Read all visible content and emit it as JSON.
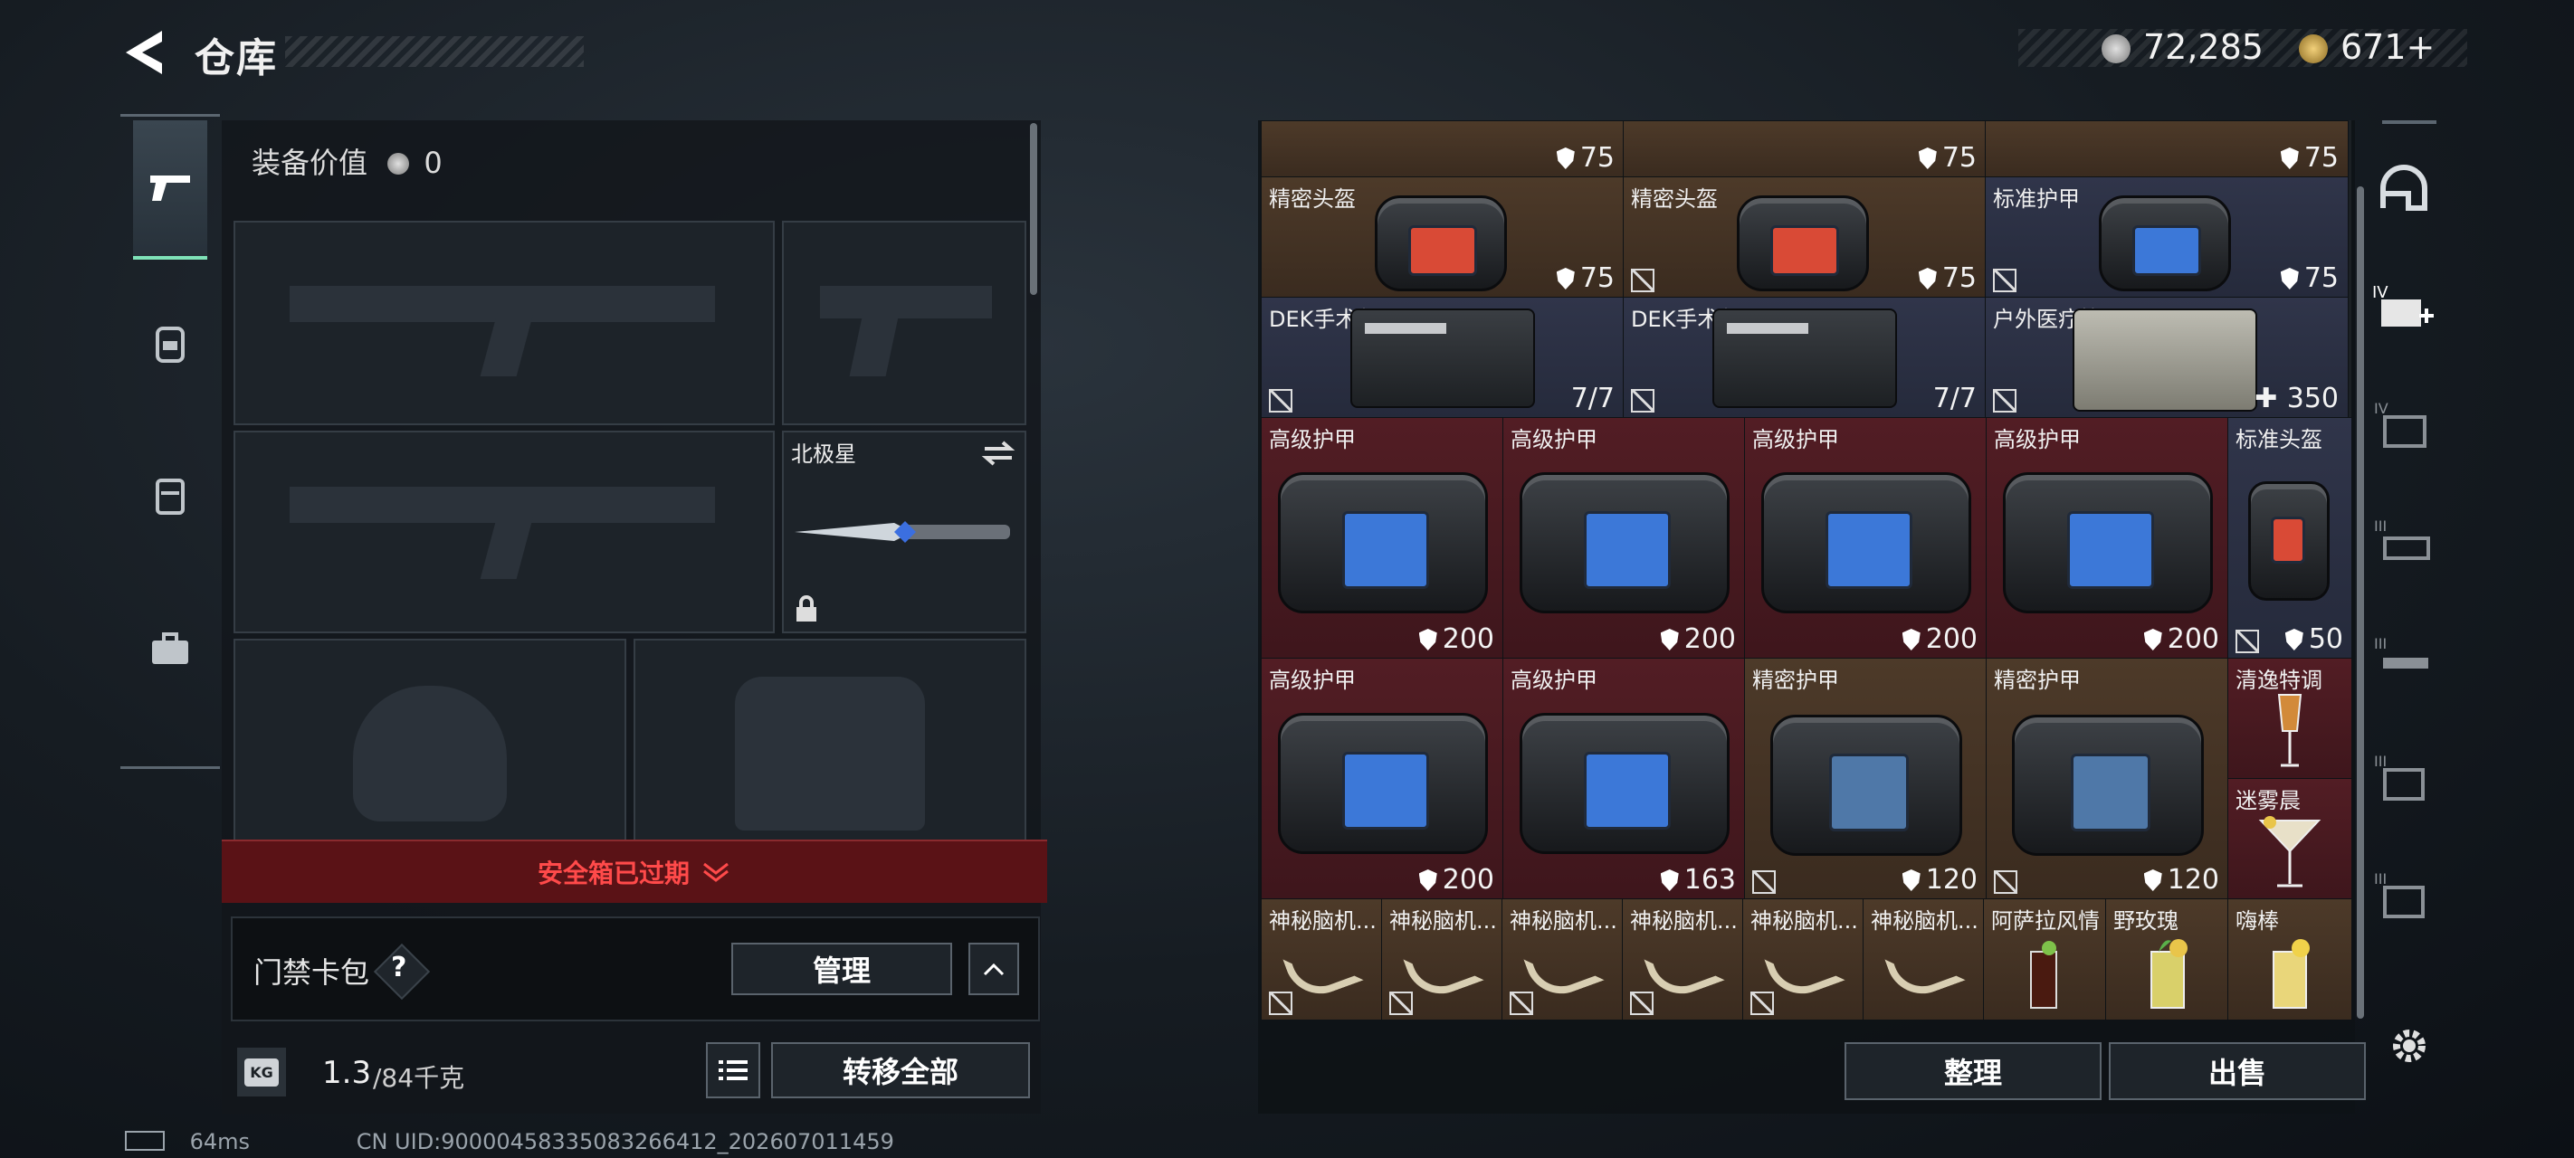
{
  "header": {
    "title": "仓库"
  },
  "currency": [
    {
      "value": "72,285",
      "color": "#b9b9b9"
    },
    {
      "value": "671+",
      "color": "#c7a24a"
    }
  ],
  "loadout": {
    "equipment_value_label": "装备价值",
    "equipment_value": "0",
    "melee_name": "北极星",
    "safe_box_text": "安全箱已过期",
    "access_card_label": "门禁卡包",
    "help_icon": "?",
    "manage_label": "管理",
    "weight_current": "1.3",
    "weight_max": "/84千克",
    "weight_badge": "KG",
    "transfer_all_label": "转移全部"
  },
  "stash": {
    "top_values": [
      "75",
      "75",
      "75"
    ],
    "row1": [
      {
        "name": "精密头盔",
        "value": "75"
      },
      {
        "name": "精密头盔",
        "value": "75"
      },
      {
        "name": "标准护甲",
        "value": "75"
      }
    ],
    "row2": [
      {
        "name": "DEK手术包",
        "value": "7/7"
      },
      {
        "name": "DEK手术包",
        "value": "7/7"
      },
      {
        "name": "户外医疗箱",
        "value": "350"
      }
    ],
    "row3": [
      {
        "name": "高级护甲",
        "value": "200"
      },
      {
        "name": "高级护甲",
        "value": "200"
      },
      {
        "name": "高级护甲",
        "value": "200"
      },
      {
        "name": "高级护甲",
        "value": "200"
      },
      {
        "name": "标准头盔",
        "value": "50"
      }
    ],
    "row4": [
      {
        "name": "高级护甲",
        "value": "200"
      },
      {
        "name": "高级护甲",
        "value": "163"
      },
      {
        "name": "精密护甲",
        "value": "120"
      },
      {
        "name": "精密护甲",
        "value": "120"
      },
      {
        "name": "清逸特调"
      },
      {
        "name": "迷雾晨"
      }
    ],
    "row5": [
      {
        "name": "神秘脑机..."
      },
      {
        "name": "神秘脑机..."
      },
      {
        "name": "神秘脑机..."
      },
      {
        "name": "神秘脑机..."
      },
      {
        "name": "神秘脑机..."
      },
      {
        "name": "神秘脑机..."
      },
      {
        "name": "阿萨拉风情"
      },
      {
        "name": "野玫瑰"
      },
      {
        "name": "嗨棒"
      }
    ],
    "sort_label": "整理",
    "sell_label": "出售"
  },
  "status": {
    "ping": "64ms",
    "uid": "CN UID:9000045833508326641​2_202607011459"
  },
  "colors": {
    "brown": "#4d3a29",
    "navy": "#30354a",
    "red": "#521d24",
    "safe_red": "#ff4a4a",
    "active_green": "#7fe3b8"
  }
}
